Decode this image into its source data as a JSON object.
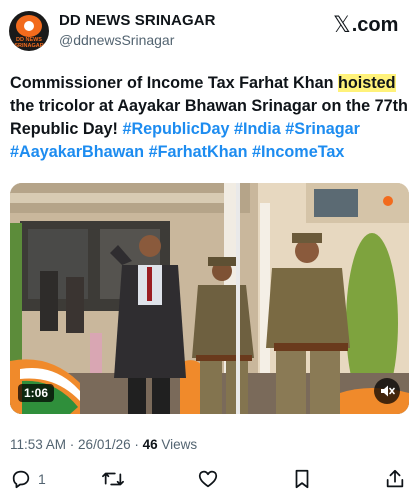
{
  "account": {
    "name": "DD NEWS SRINAGAR",
    "handle": "@ddnewsSrinagar",
    "avatar_text_1": "DD NEWS",
    "avatar_text_2": "SRINAGAR",
    "avatar_color": "#f26b1d"
  },
  "brand": {
    "icon": "x-logo-icon",
    "label": ".com"
  },
  "tweet": {
    "text_1": "Commissioner of Income Tax Farhat Khan ",
    "highlight": "hoisted",
    "text_2": " the tricolor at Aayakar Bhawan Srinagar on the 77th Republic Day! ",
    "hashtags": [
      "#RepublicDay",
      "#India",
      "#Srinagar",
      "#AayakarBhawan",
      "#FarhatKhan",
      "#IncomeTax"
    ],
    "hashtag_color": "#1d8cf0",
    "highlight_color": "#fff27a"
  },
  "media": {
    "duration": "1:06",
    "mute_icon": "speaker-muted-icon"
  },
  "meta": {
    "time": "11:53 AM",
    "separator": " · ",
    "date": "26/01/26",
    "views_count": "46",
    "views_label": " Views"
  },
  "actions": {
    "reply_icon": "reply-icon",
    "reply_count": "1",
    "retweet_icon": "retweet-icon",
    "like_icon": "heart-icon",
    "bookmark_icon": "bookmark-icon",
    "share_icon": "share-icon"
  }
}
